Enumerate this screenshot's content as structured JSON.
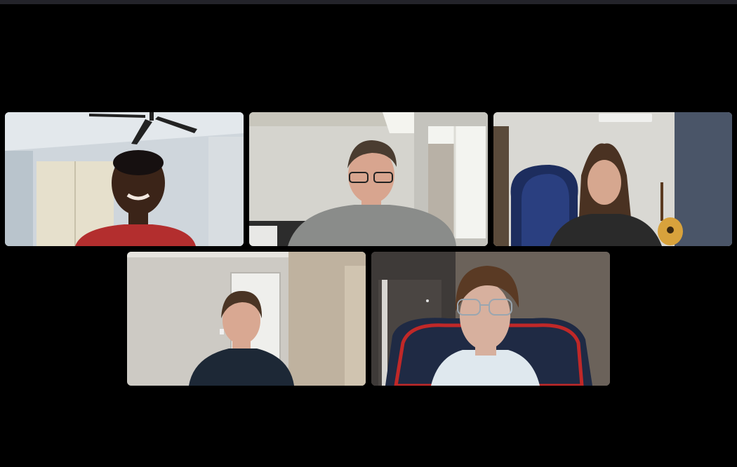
{
  "meeting": {
    "layout": "gallery",
    "participant_count": 5
  },
  "participants": [
    {
      "id": "p1",
      "name": "",
      "shirt_color": "#b32e2e",
      "wall_color": "#cfd6dc"
    },
    {
      "id": "p2",
      "name": "",
      "shirt_color": "#8a8c8a",
      "wall_color": "#d5d4ce"
    },
    {
      "id": "p3",
      "name": "",
      "shirt_color": "#2a2a2a",
      "wall_color": "#d9d8d3"
    },
    {
      "id": "p4",
      "name": "",
      "shirt_color": "#1d2836",
      "wall_color": "#cdcac4"
    },
    {
      "id": "p5",
      "name": "",
      "shirt_color": "#1f2a44",
      "wall_color": "#5b534d"
    }
  ]
}
